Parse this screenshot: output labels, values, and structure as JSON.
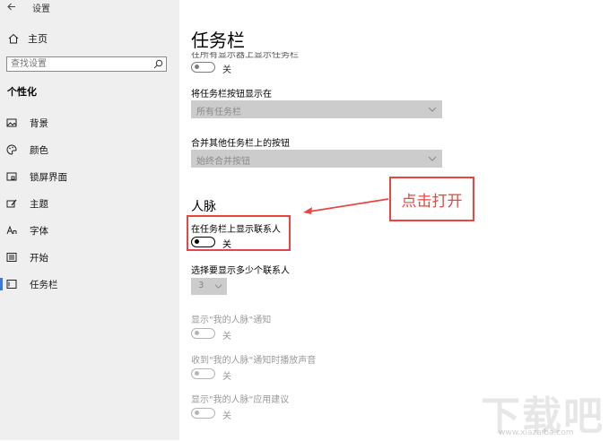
{
  "app": {
    "title": "设置"
  },
  "sidebar": {
    "home_label": "主页",
    "search_placeholder": "查找设置",
    "section_title": "个性化",
    "items": [
      {
        "label": "背景",
        "icon": "image-icon"
      },
      {
        "label": "颜色",
        "icon": "palette-icon"
      },
      {
        "label": "锁屏界面",
        "icon": "lock-screen-icon"
      },
      {
        "label": "主题",
        "icon": "theme-brush-icon"
      },
      {
        "label": "字体",
        "icon": "font-icon"
      },
      {
        "label": "开始",
        "icon": "start-icon"
      },
      {
        "label": "任务栏",
        "icon": "taskbar-icon",
        "active": true
      }
    ]
  },
  "main": {
    "title": "任务栏",
    "cut_off_label": "在所有显示器上显示任务栏",
    "cut_off_toggle_state": "关",
    "buttons_location": {
      "label": "将任务栏按钮显示在",
      "value": "所有任务栏"
    },
    "combine_buttons": {
      "label": "合并其他任务栏上的按钮",
      "value": "始终合并按钮"
    },
    "people": {
      "heading": "人脉",
      "show_contacts": {
        "label": "在任务栏上显示联系人",
        "state": "关"
      },
      "contact_count": {
        "label": "选择要显示多少个联系人",
        "value": "3"
      },
      "notifications": {
        "label": "显示\"我的人脉\"通知",
        "state": "关"
      },
      "notification_sound": {
        "label": "收到\"我的人脉\"通知时播放声音",
        "state": "关"
      },
      "app_suggestions": {
        "label": "显示\"我的人脉\"应用建议",
        "state": "关"
      }
    }
  },
  "annotation": {
    "text": "点击打开",
    "color": "#e84545"
  },
  "watermark": {
    "text": "下载吧",
    "url": "www.xiazaiba.com"
  },
  "colors": {
    "accent": "#3a7bd5",
    "sidebar_bg": "#efeff0",
    "dropdown_bg": "#cccccc"
  }
}
